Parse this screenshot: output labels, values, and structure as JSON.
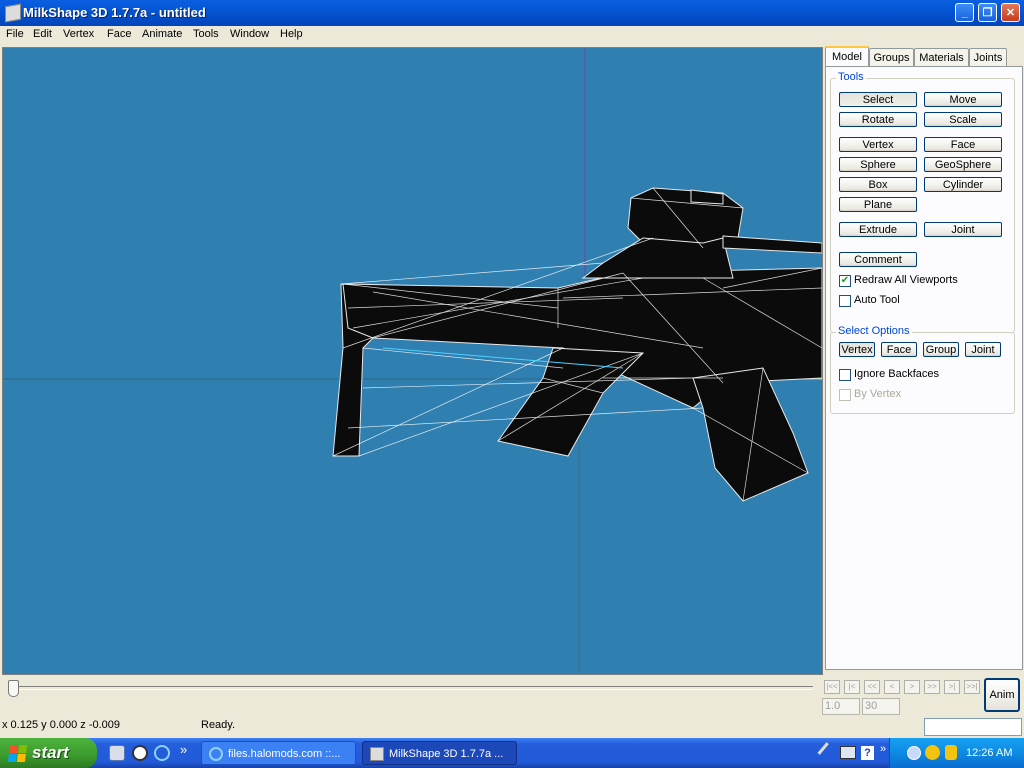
{
  "window": {
    "title": "MilkShape 3D 1.7.7a - untitled"
  },
  "menu": [
    "File",
    "Edit",
    "Vertex",
    "Face",
    "Animate",
    "Tools",
    "Window",
    "Help"
  ],
  "tabs": [
    "Model",
    "Groups",
    "Materials",
    "Joints"
  ],
  "tools": {
    "label": "Tools",
    "select": "Select",
    "move": "Move",
    "rotate": "Rotate",
    "scale": "Scale",
    "vertex": "Vertex",
    "face": "Face",
    "sphere": "Sphere",
    "geosphere": "GeoSphere",
    "box": "Box",
    "cylinder": "Cylinder",
    "plane": "Plane",
    "extrude": "Extrude",
    "joint": "Joint",
    "comment": "Comment",
    "redraw_all": "Redraw All Viewports",
    "auto_tool": "Auto Tool"
  },
  "select_options": {
    "label": "Select Options",
    "vertex": "Vertex",
    "face": "Face",
    "group": "Group",
    "joint": "Joint",
    "ignore_backfaces": "Ignore Backfaces",
    "by_vertex": "By Vertex"
  },
  "checkbox_states": {
    "redraw_all": true,
    "auto_tool": false,
    "ignore_backfaces": false,
    "by_vertex": false
  },
  "anim": {
    "nav": [
      "|<<",
      "|<",
      "<<",
      "<",
      ">",
      ">>",
      ">|",
      ">>|"
    ],
    "frame_current": "1.0",
    "frame_total": "30",
    "button": "Anim"
  },
  "status": {
    "coords": "x 0.125 y 0.000 z -0.009",
    "message": "Ready."
  },
  "taskbar": {
    "start": "start",
    "quicklaunch_more": "»",
    "tasks": [
      "files.halomods.com ::...",
      "MilkShape 3D 1.7.7a ..."
    ],
    "clock": "12:26 AM"
  },
  "colors": {
    "viewport_bg": "#2f7fb0",
    "titlebar": "#0455d4",
    "start_green": "#3c9a2d"
  }
}
